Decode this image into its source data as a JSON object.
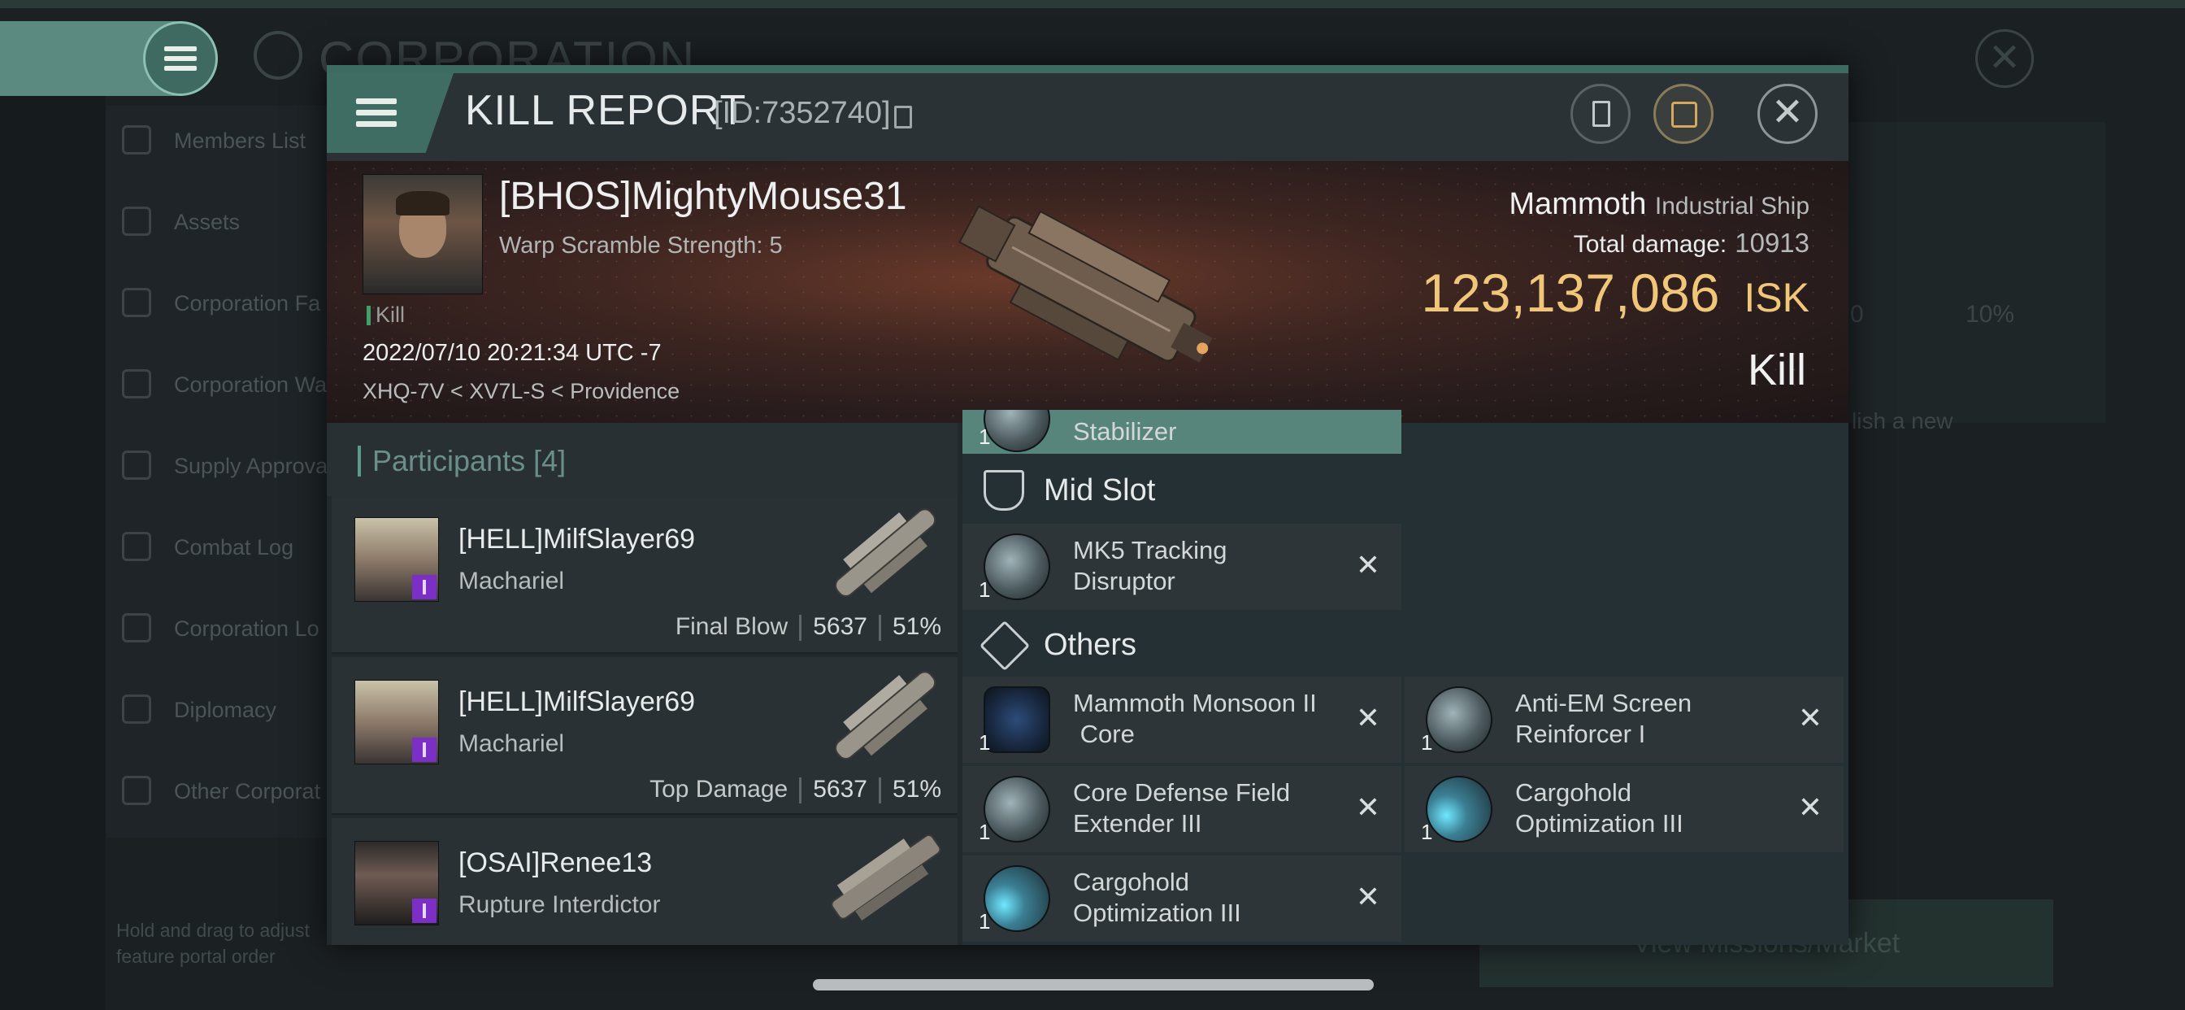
{
  "background": {
    "title": "CORPORATION",
    "sidebar": [
      "Members List",
      "Assets",
      "Corporation Fa",
      "Corporation Wa",
      "Supply Approva",
      "Combat Log",
      "Corporation Lo",
      "Diplomacy",
      "Other Corporat"
    ],
    "hint": "Hold and drag to adjust feature portal order",
    "bottom_button": "View Missions/Market",
    "right_fragments": [
      "0",
      "10%",
      "lish a new"
    ]
  },
  "kill_report": {
    "title": "KILL REPORT",
    "id": "[ID:7352740]",
    "victim": {
      "name": "[BHOS]MightyMouse31",
      "subtitle": "Warp Scramble Strength: 5",
      "tag": "Kill",
      "datetime": "2022/07/10 20:21:34 UTC -7",
      "location": "XHQ-7V < XV7L-S < Providence"
    },
    "ship": {
      "name": "Mammoth",
      "class": "Industrial Ship",
      "total_damage_label": "Total damage:",
      "total_damage": "10913",
      "value": "123,137,086",
      "currency": "ISK",
      "kill_type": "Kill"
    },
    "participants": {
      "label": "Participants",
      "count": "[4]",
      "rows": [
        {
          "name": "[HELL]MilfSlayer69",
          "ship": "Machariel",
          "role": "Final Blow",
          "damage": "5637",
          "pct": "51%"
        },
        {
          "name": "[HELL]MilfSlayer69",
          "ship": "Machariel",
          "role": "Top Damage",
          "damage": "5637",
          "pct": "51%"
        },
        {
          "name": "[OSAI]Renee13",
          "ship": "Rupture Interdictor",
          "role": "",
          "damage": "",
          "pct": ""
        }
      ]
    },
    "fitting": {
      "partial_item": {
        "qty": "1",
        "name": "Stabilizer"
      },
      "mid_slot_label": "Mid Slot",
      "mid_items": [
        {
          "qty": "1",
          "line1": "MK5 Tracking",
          "line2": "Disruptor"
        }
      ],
      "others_label": "Others",
      "others_items": [
        {
          "qty": "1",
          "line1": "Mammoth Monsoon II",
          "line2": " Core"
        },
        {
          "qty": "1",
          "line1": "Anti-EM Screen",
          "line2": "Reinforcer I"
        },
        {
          "qty": "1",
          "line1": "Core Defense Field",
          "line2": "Extender III"
        },
        {
          "qty": "1",
          "line1": "Cargohold",
          "line2": "Optimization III"
        },
        {
          "qty": "1",
          "line1": "Cargohold",
          "line2": "Optimization III"
        }
      ]
    }
  }
}
